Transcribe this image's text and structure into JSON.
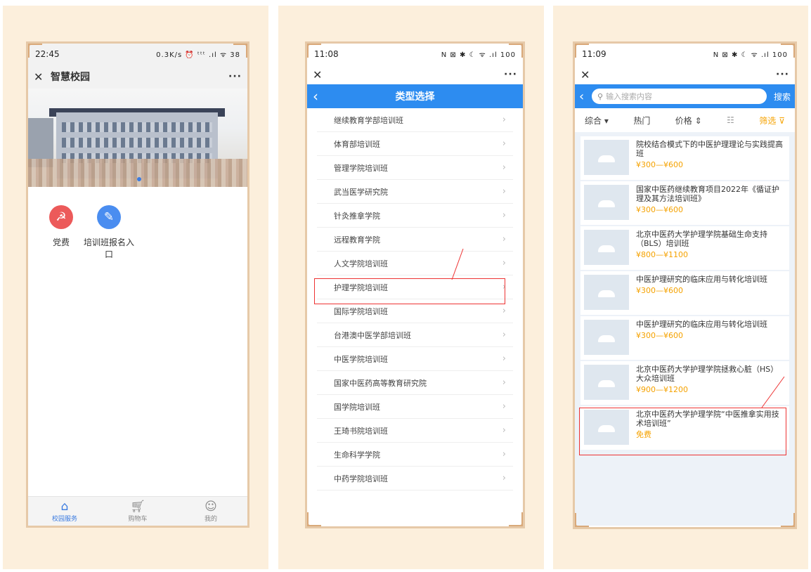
{
  "phone1": {
    "status_time": "22:45",
    "status_right": "0.3K/s ⏰ ᵗᵗᵗ .ıl ᯤ 38",
    "close_icon": "close-icon",
    "title": "智慧校园",
    "more": "···",
    "quick_items": [
      {
        "label": "党费",
        "icon": "party-icon",
        "color": "#ec5a5a"
      },
      {
        "label": "培训班报名入口",
        "icon": "edit-icon",
        "color": "#4a8df0"
      }
    ],
    "tabs": [
      {
        "label": "校园服务",
        "icon": "home-icon"
      },
      {
        "label": "购物车",
        "icon": "cart-icon"
      },
      {
        "label": "我的",
        "icon": "user-icon"
      }
    ]
  },
  "phone2": {
    "status_time": "11:08",
    "status_right": "N ⊠ ✱ ☾ ᯤ .ıl 100",
    "close_icon": "close-icon",
    "more": "···",
    "header_title": "类型选择",
    "categories": [
      "继续教育学部培训班",
      "体育部培训班",
      "管理学院培训班",
      "武当医学研究院",
      "针灸推拿学院",
      "远程教育学院",
      "人文学院培训班",
      "护理学院培训班",
      "国际学院培训班",
      "台港澳中医学部培训班",
      "中医学院培训班",
      "国家中医药高等教育研究院",
      "国学院培训班",
      "王琦书院培训班",
      "生命科学学院",
      "中药学院培训班"
    ]
  },
  "phone3": {
    "status_time": "11:09",
    "status_right": "N ⊠ ✱ ☾ ᯤ .ıl 100",
    "close_icon": "close-icon",
    "more": "···",
    "search_placeholder": "输入搜索内容",
    "search_button": "搜索",
    "filters": [
      "综合 ▾",
      "热门",
      "价格 ⇕",
      "筛选"
    ],
    "products": [
      {
        "title": "院校结合模式下的中医护理理论与实践提高班",
        "price": "¥300—¥600"
      },
      {
        "title": "国家中医药继续教育项目2022年《循证护理及其方法培训班》",
        "price": "¥300—¥600"
      },
      {
        "title": "北京中医药大学护理学院基础生命支持（BLS）培训班",
        "price": "¥800—¥1100"
      },
      {
        "title": "中医护理研究的临床应用与转化培训班",
        "price": "¥300—¥600"
      },
      {
        "title": "中医护理研究的临床应用与转化培训班",
        "price": "¥300—¥600"
      },
      {
        "title": "北京中医药大学护理学院拯救心脏（HS）大众培训班",
        "price": "¥900—¥1200"
      },
      {
        "title": "北京中医药大学护理学院“中医推拿实用技术培训班”",
        "price": "免费"
      }
    ]
  },
  "colors": {
    "accent": "#2d8cf0",
    "price": "#f5a200",
    "highlight": "#e33333",
    "frame": "#fcefdc"
  }
}
